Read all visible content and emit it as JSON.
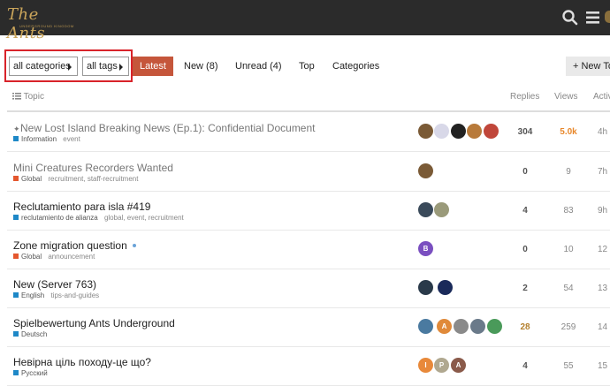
{
  "header": {
    "logo_text": "The Ants",
    "logo_sub": "UNDERGROUND KINGDOM"
  },
  "nav": {
    "categories_dropdown": "all categories",
    "tags_dropdown": "all tags",
    "tabs": [
      "Latest",
      "New (8)",
      "Unread (4)",
      "Top",
      "Categories"
    ],
    "new_topic": "+ New To"
  },
  "columns": {
    "topic": "Topic",
    "replies": "Replies",
    "views": "Views",
    "activity": "Activ"
  },
  "topics": [
    {
      "title": "New Lost Island Breaking News (Ep.1): Confidential Document",
      "category": "Information",
      "category_color": "#1e88c7",
      "tags": "event",
      "replies": "304",
      "views": "5.0k",
      "activity": "4h"
    },
    {
      "title": "Mini Creatures Recorders Wanted",
      "category": "Global",
      "category_color": "#e4572e",
      "tags": "recruitment,  staff-recruitment",
      "replies": "0",
      "views": "9",
      "activity": "7h"
    },
    {
      "title": "Reclutamiento para isla #419",
      "category": "reclutamiento de alianza",
      "category_color": "#1e88c7",
      "tags": "global,  event,  recruitment",
      "replies": "4",
      "views": "83",
      "activity": "9h"
    },
    {
      "title": "Zone migration question",
      "category": "Global",
      "category_color": "#e4572e",
      "tags": "announcement",
      "replies": "0",
      "views": "10",
      "activity": "12"
    },
    {
      "title": "New (Server 763)",
      "category": "English",
      "category_color": "#1e88c7",
      "tags": "tips-and-guides",
      "replies": "2",
      "views": "54",
      "activity": "13"
    },
    {
      "title": "Spielbewertung Ants Underground",
      "category": "Deutsch",
      "category_color": "#1e88c7",
      "tags": "",
      "replies": "28",
      "views": "259",
      "activity": "14"
    },
    {
      "title": "Невірна ціль походу-це що?",
      "category": "Русский",
      "category_color": "#1e88c7",
      "tags": "",
      "replies": "4",
      "views": "55",
      "activity": "15"
    }
  ],
  "avatar_letters": {
    "r4a": "B",
    "r6b": "A",
    "r7a": "I",
    "r7b": "P",
    "r7c": "A"
  },
  "colors": {
    "accent": "#c5563b",
    "views_hot": "#e8872b",
    "replies_hot": "#b4802e"
  }
}
